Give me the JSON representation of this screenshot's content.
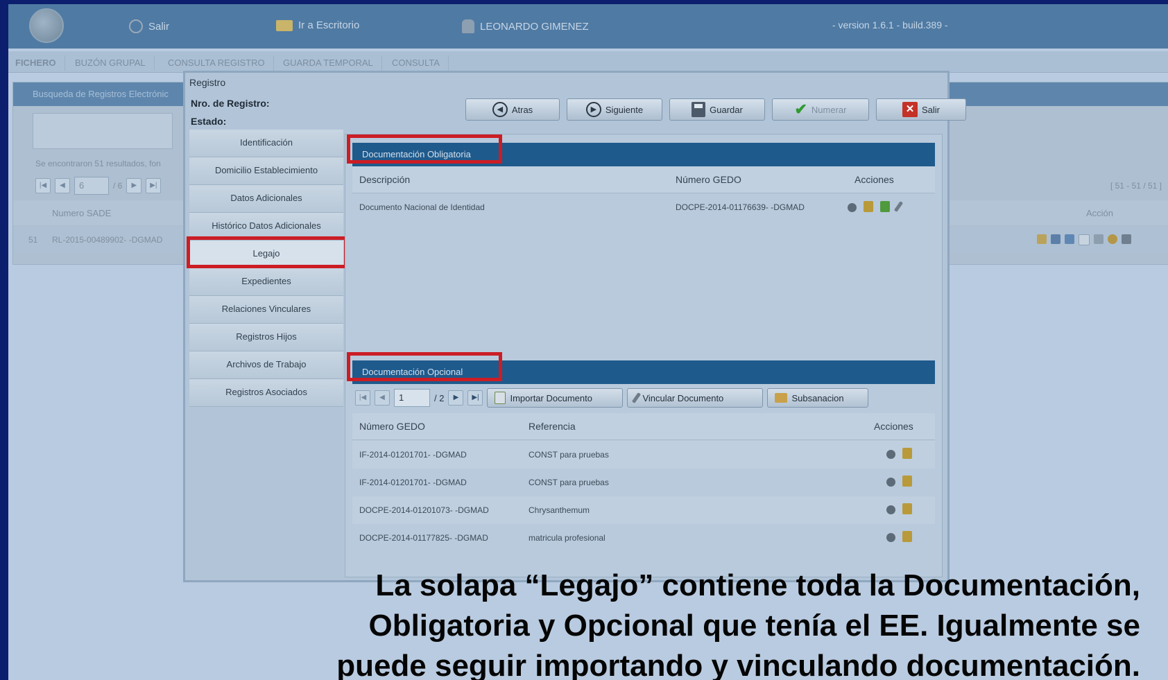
{
  "header": {
    "exit_label": "Salir",
    "desk_label": "Ir a Escritorio",
    "user_name": "LEONARDO GIMENEZ",
    "version": "- version 1.6.1 - build.389 -"
  },
  "tabs": [
    "FICHERO",
    "BUZÓN GRUPAL",
    "CONSULTA REGISTRO",
    "GUARDA TEMPORAL",
    "CONSULTA"
  ],
  "background": {
    "panel_title": "Busqueda de Registros Electrónic",
    "results_text": "Se encontraron 51 resultados, fon",
    "page_value": "6",
    "page_total": "/ 6",
    "range_text": "[ 51 - 51 / 51 ]",
    "col_numero": "Numero SADE",
    "col_accion": "Acción",
    "row_index": "51",
    "row_numero": "RL-2015-00489902- -DGMAD"
  },
  "dialog": {
    "title": "Registro",
    "nro_label": "Nro. de Registro:",
    "estado_label": "Estado:",
    "buttons": {
      "atras": "Atras",
      "siguiente": "Siguiente",
      "guardar": "Guardar",
      "numerar": "Numerar",
      "salir": "Salir"
    },
    "menu": [
      "Identificación",
      "Domicilio Establecimiento",
      "Datos Adicionales",
      "Histórico Datos Adicionales",
      "Legajo",
      "Expedientes",
      "Relaciones Vinculares",
      "Registros Hijos",
      "Archivos de Trabajo",
      "Registros Asociados"
    ],
    "obligatoria": {
      "title": "Documentación Obligatoria",
      "col_descripcion": "Descripción",
      "col_numero": "Número GEDO",
      "col_acciones": "Acciones",
      "rows": [
        {
          "descripcion": "Documento Nacional de Identidad",
          "numero": "DOCPE-2014-01176639- -DGMAD"
        }
      ]
    },
    "opcional": {
      "title": "Documentación Opcional",
      "page_value": "1",
      "page_total": "/ 2",
      "btn_importar": "Importar Documento",
      "btn_vincular": "Vincular Documento",
      "btn_subsanacion": "Subsanacion",
      "col_numero": "Número GEDO",
      "col_referencia": "Referencia",
      "col_acciones": "Acciones",
      "rows": [
        {
          "numero": "IF-2014-01201701- -DGMAD",
          "referencia": "CONST para pruebas"
        },
        {
          "numero": "IF-2014-01201701- -DGMAD",
          "referencia": "CONST para pruebas"
        },
        {
          "numero": "DOCPE-2014-01201073- -DGMAD",
          "referencia": "Chrysanthemum"
        },
        {
          "numero": "DOCPE-2014-01177825- -DGMAD",
          "referencia": "matricula profesional"
        }
      ]
    }
  },
  "caption": {
    "line1": "La solapa “Legajo” contiene toda la Documentación,",
    "line2": "Obligatoria y Opcional que tenía el EE. Igualmente se",
    "line3": "puede seguir importando y vinculando documentación."
  },
  "colors": {
    "frame": "#0c1f6e",
    "header": "#4f7aa3",
    "section_header": "#1f5a8c",
    "highlight": "#cc1d25"
  }
}
